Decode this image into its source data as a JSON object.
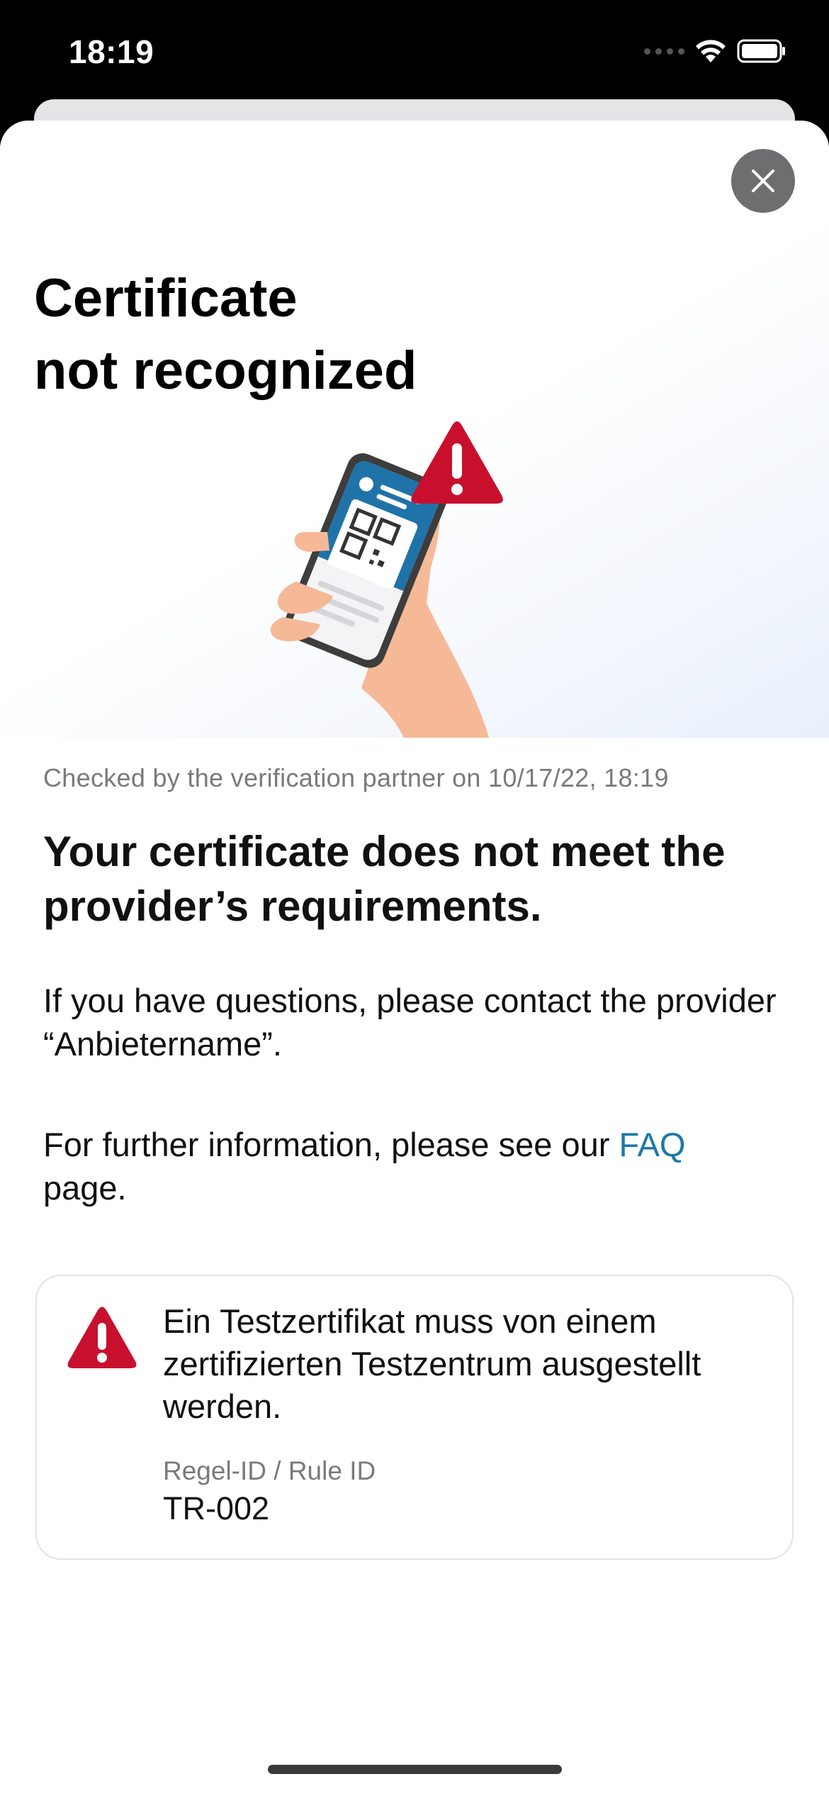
{
  "status_bar": {
    "time": "18:19"
  },
  "header": {
    "title_line1": "Certificate",
    "title_line2": "not recognized",
    "close_icon": "close-icon"
  },
  "result": {
    "checked_text": "Checked by the verification partner on 10/17/22, 18:19",
    "headline": "Your certificate does not meet the provider’s requirements.",
    "contact_text": "If you have questions, please contact the provider “Anbietername”.",
    "info_prefix": "For further information, please see our ",
    "faq_link": "FAQ",
    "info_suffix": "page."
  },
  "rule": {
    "icon": "warning-icon",
    "message": "Ein Testzertifikat muss von einem zertifizierten Testzentrum ausgestellt werden.",
    "id_label": "Regel-ID / Rule ID",
    "id_value": "TR-002"
  },
  "colors": {
    "warning_red": "#c8102e",
    "link_blue": "#1a78a8",
    "close_grey": "#6e6e70",
    "accent_blue": "#1f73a8"
  }
}
